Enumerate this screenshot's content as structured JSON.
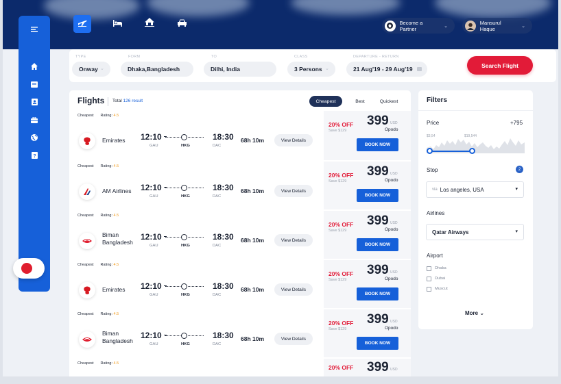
{
  "nav": {
    "tabs": [
      "flight-tab",
      "hotel-tab",
      "home-tab",
      "car-tab"
    ],
    "partner_label": "Become a Partner",
    "user_name": "Mansurul Haque"
  },
  "sidebar": {
    "icons": [
      "home-icon",
      "inbox-icon",
      "document-icon",
      "briefcase-icon",
      "globe-icon",
      "help-icon"
    ]
  },
  "search": {
    "type_label": "TYPE",
    "type_value": "Onway",
    "from_label": "FORM",
    "from_value": "Dhaka,Bangladesh",
    "to_label": "TO",
    "to_value": "Dilhi, India",
    "class_label": "CLASS",
    "class_value": "3 Persons",
    "dates_label": "DEPARTURE - RETURN",
    "dates_value": "21 Aug'19 - 29 Aug'19",
    "button_label": "Search Flight"
  },
  "flights": {
    "title": "Flights",
    "total_label": "Total",
    "total_count": "126 result",
    "sort_options": [
      "Cheapest",
      "Best",
      "Quickest"
    ],
    "rows": [
      {
        "tag": "Cheapest",
        "rating_label": "Rating:",
        "rating": "4.5",
        "airline": "Emirates",
        "dep": "12:10",
        "arr": "18:30",
        "from": "GAU",
        "via": "HKG",
        "to": "DAC",
        "duration": "68h 10m",
        "details": "View Details",
        "off": "20% OFF",
        "save": "Save $129",
        "price": "399",
        "currency": "USD",
        "vendor": "Opodo",
        "book": "BOOK NOW"
      },
      {
        "tag": "Cheapest",
        "rating_label": "Rating:",
        "rating": "4.5",
        "airline": "AM Airlines",
        "dep": "12:10",
        "arr": "18:30",
        "from": "GAU",
        "via": "HKG",
        "to": "DAC",
        "duration": "68h 10m",
        "details": "View Details",
        "off": "20% OFF",
        "save": "Save $129",
        "price": "399",
        "currency": "USD",
        "vendor": "Opodo",
        "book": "BOOK NOW"
      },
      {
        "tag": "Cheapest",
        "rating_label": "Rating:",
        "rating": "4.5",
        "airline": "Biman Bangladesh",
        "dep": "12:10",
        "arr": "18:30",
        "from": "GAU",
        "via": "HKG",
        "to": "DAC",
        "duration": "68h 10m",
        "details": "View Details",
        "off": "20% OFF",
        "save": "Save $129",
        "price": "399",
        "currency": "USD",
        "vendor": "Opodo",
        "book": "BOOK NOW"
      },
      {
        "tag": "Cheapest",
        "rating_label": "Rating:",
        "rating": "4.5",
        "airline": "Emirates",
        "dep": "12:10",
        "arr": "18:30",
        "from": "GAU",
        "via": "HKG",
        "to": "DAC",
        "duration": "68h 10m",
        "details": "View Details",
        "off": "20% OFF",
        "save": "Save $129",
        "price": "399",
        "currency": "USD",
        "vendor": "Opodo",
        "book": "BOOK NOW"
      },
      {
        "tag": "Cheapest",
        "rating_label": "Rating:",
        "rating": "4.5",
        "airline": "Biman Bangladesh",
        "dep": "12:10",
        "arr": "18:30",
        "from": "GAU",
        "via": "HKG",
        "to": "DAC",
        "duration": "68h 10m",
        "details": "View Details",
        "off": "20% OFF",
        "save": "Save $129",
        "price": "399",
        "currency": "USD",
        "vendor": "Opodo",
        "book": "BOOK NOW"
      },
      {
        "tag": "Cheapest",
        "rating_label": "Rating:",
        "rating": "4.5",
        "off": "20% OFF",
        "price": "399",
        "currency": "USD"
      }
    ]
  },
  "filters": {
    "title": "Filters",
    "price_label": "Price",
    "price_more": "+795",
    "price_min": "$3,54",
    "price_max": "$19,544",
    "stop_label": "Stop",
    "stop_count": "2",
    "stop_via": "via",
    "stop_value": "Los angeles, USA",
    "airlines_label": "Airlines",
    "airlines_value": "Qatar Airways",
    "airport_label": "Airport",
    "airports": [
      "Dhaka",
      "Dubai",
      "Muscut"
    ],
    "more_label": "More"
  },
  "colors": {
    "primary": "#1660d9",
    "accent": "#e21b38",
    "hero": "#0c2a6b",
    "rating": "#f19a1a"
  }
}
